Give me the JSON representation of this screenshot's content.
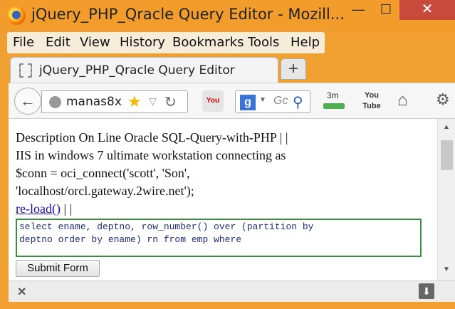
{
  "window": {
    "title": "jQuery_PHP_Qracle Query Editor - Mozill...",
    "minimize_glyph": "—",
    "maximize_glyph": "☐",
    "close_glyph": "✕"
  },
  "menu": {
    "items": [
      "File",
      "Edit",
      "View",
      "History",
      "Bookmarks",
      "Tools",
      "Help"
    ]
  },
  "tab": {
    "label": "jQuery_PHP_Qracle Query Editor",
    "new_tab_glyph": "+"
  },
  "nav": {
    "url": "manas8x.",
    "search_placeholder": "Gc",
    "google_glyph": "g",
    "threem_label": "3m",
    "youtube_label": "You Tube"
  },
  "page": {
    "description_lines": [
      "Description On Line Oracle SQL-Query-with-PHP | |",
      "IIS in windows 7 ultimate workstation connecting as",
      "$conn = oci_connect('scott', 'Son',",
      "'localhost/orcl.gateway.2wire.net');"
    ],
    "reload_link": "re-load()",
    "reload_suffix": " | |",
    "query_text": "select ename, deptno, row_number() over (partition by\ndeptno order by ename) rn from emp where",
    "submit_label": "Submit Form"
  },
  "colors": {
    "titlebar": "#f29c2b",
    "close_button": "#c74a3b",
    "link": "#1a0dab",
    "query_border": "#3c8d3c",
    "query_text": "#1f2b7a"
  },
  "icons": [
    "firefox-logo",
    "back-arrow-icon",
    "globe-icon",
    "star-icon",
    "dropdown-icon",
    "reload-icon",
    "youtube-icon",
    "google-icon",
    "search-icon",
    "home-icon",
    "close-icon",
    "download-icon"
  ]
}
